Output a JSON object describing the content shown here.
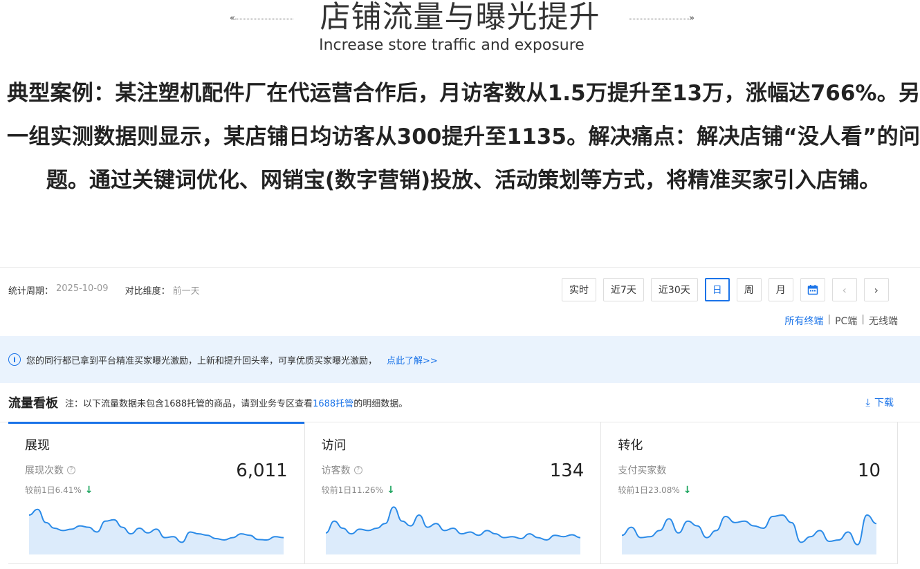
{
  "header": {
    "title": "店铺流量与曝光提升",
    "subtitle": "Increase store traffic and exposure",
    "deco_left_icon": "double-chevron-left-icon",
    "deco_right_icon": "double-chevron-right-icon"
  },
  "description": "典型案例：某注塑机配件厂在代运营合作后，月访客数从1.5万提升至13万，涨幅达766%。另一组实测数据则显示，某店铺日均访客从300提升至1135。解决痛点：解决店铺“没人看”的问题。通过关键词优化、网销宝(数字营销)投放、活动策划等方式，将精准买家引入店铺。",
  "dashboard": {
    "period_label": "统计周期：",
    "period_value": "2025-10-09",
    "compare_label": "对比维度：",
    "compare_value": "前一天",
    "controls": {
      "realtime": "实时",
      "last7": "近7天",
      "last30": "近30天",
      "day": "日",
      "week": "周",
      "month": "月"
    },
    "terminals": {
      "all": "所有终端",
      "sep": "|",
      "pc": "PC端",
      "wireless": "无线端"
    },
    "notice": {
      "text": "您的同行都已拿到平台精准买家曝光激励，上新和提升回头率，可享优质买家曝光激励，",
      "link": "点此了解>>"
    },
    "board": {
      "title": "流量看板",
      "note_prefix": "注：以下流量数据未包含1688托管的商品，请到业务专区查看",
      "note_link": "1688托管",
      "note_suffix": "的明细数据。",
      "download": "下载"
    },
    "cards": [
      {
        "title": "展现",
        "metric": "展现次数",
        "value": "6,011",
        "compare": "较前1日6.41%",
        "trend": [
          0.78,
          0.9,
          0.62,
          0.5,
          0.45,
          0.48,
          0.55,
          0.52,
          0.42,
          0.65,
          0.68,
          0.52,
          0.38,
          0.5,
          0.4,
          0.48,
          0.3,
          0.32,
          0.2,
          0.42,
          0.38,
          0.35,
          0.28,
          0.25,
          0.3,
          0.38,
          0.35,
          0.26,
          0.25,
          0.32,
          0.3
        ]
      },
      {
        "title": "访问",
        "metric": "访客数",
        "value": "134",
        "compare": "较前1日11.26%",
        "trend": [
          0.4,
          0.65,
          0.5,
          0.38,
          0.48,
          0.45,
          0.5,
          0.6,
          0.95,
          0.65,
          0.55,
          0.78,
          0.52,
          0.6,
          0.45,
          0.5,
          0.38,
          0.42,
          0.35,
          0.45,
          0.38,
          0.3,
          0.32,
          0.28,
          0.38,
          0.3,
          0.25,
          0.35,
          0.32,
          0.36,
          0.3
        ]
      },
      {
        "title": "转化",
        "metric": "支付买家数",
        "value": "10",
        "compare": "较前1日23.08%",
        "trend": [
          0.35,
          0.52,
          0.3,
          0.32,
          0.45,
          0.7,
          0.4,
          0.65,
          0.55,
          0.3,
          0.45,
          0.75,
          0.62,
          0.65,
          0.55,
          0.5,
          0.75,
          0.78,
          0.62,
          0.2,
          0.32,
          0.45,
          0.22,
          0.25,
          0.42,
          0.15,
          0.78,
          0.6
        ]
      }
    ]
  },
  "colors": {
    "accent": "#1a73e8",
    "down": "#17a35b",
    "spark_line": "#2b8be8",
    "spark_fill": "#dcebfb"
  }
}
